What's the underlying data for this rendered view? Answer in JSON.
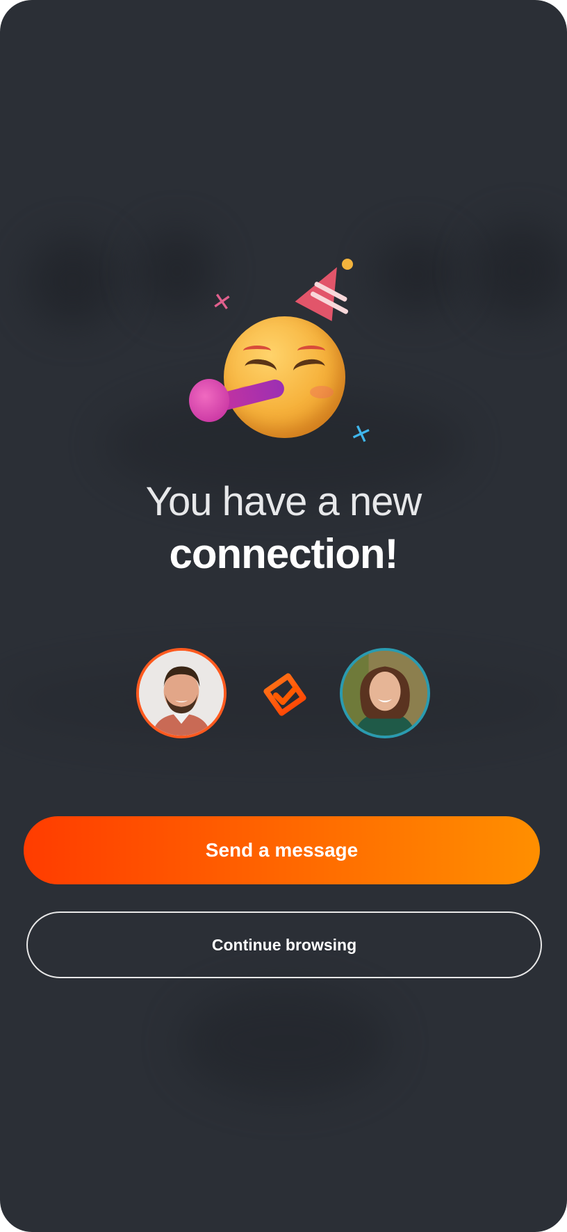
{
  "screen": {
    "background_color": "#2b2f36"
  },
  "illustration": {
    "emoji": "party-face-emoji",
    "decorations": [
      "party-hat-icon",
      "party-horn-icon",
      "sparkle-pink-icon",
      "sparkle-blue-icon"
    ]
  },
  "headline": {
    "line1": "You have a new",
    "line2": "connection!"
  },
  "connection": {
    "left_avatar": {
      "icon": "avatar-man-icon",
      "ring_color": "#ff5a1f"
    },
    "link_icon": "connection-check-icon",
    "right_avatar": {
      "icon": "avatar-woman-icon",
      "ring_color": "#2a9bb0"
    }
  },
  "actions": {
    "primary_label": "Send a message",
    "secondary_label": "Continue browsing",
    "accent_color": "#ff5a00"
  }
}
